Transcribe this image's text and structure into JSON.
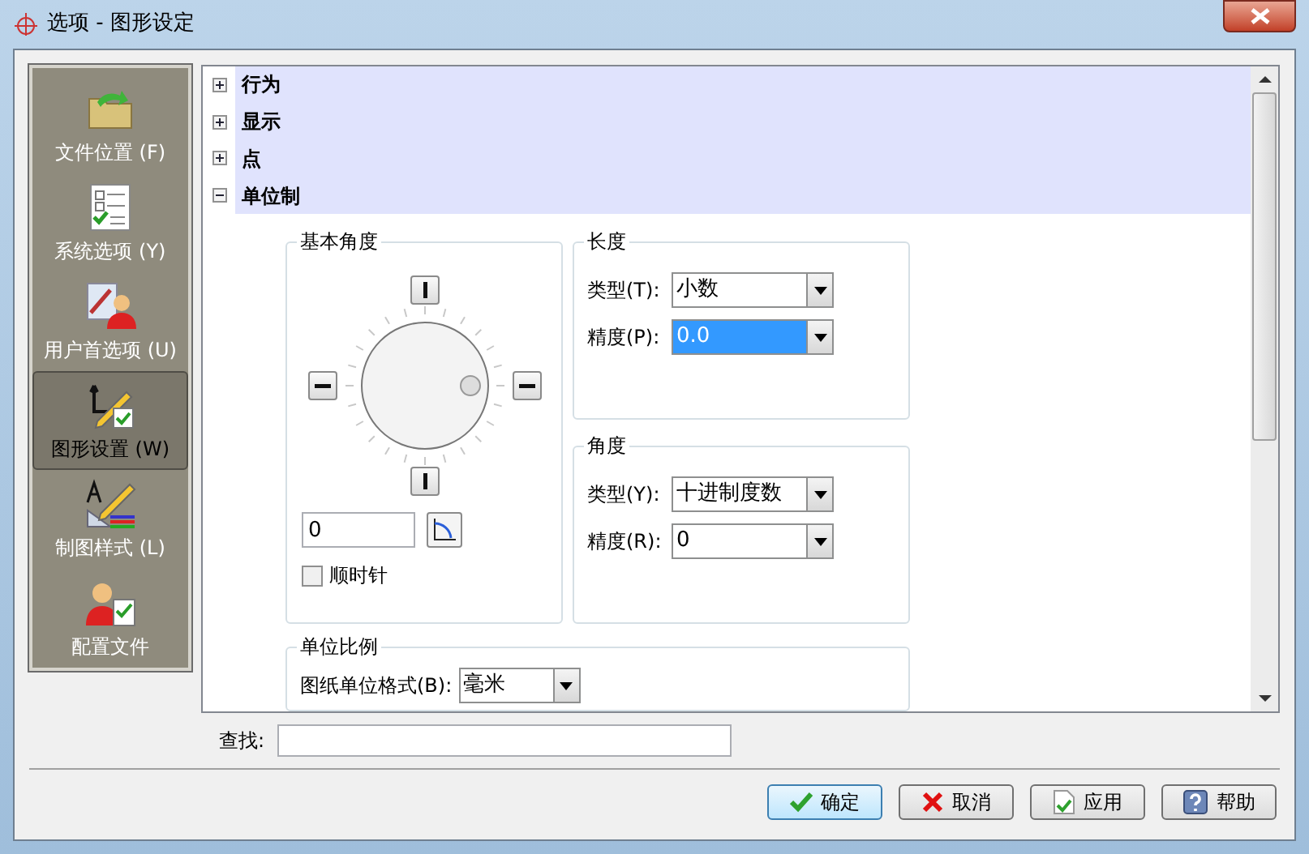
{
  "window": {
    "title": "选项 - 图形设定"
  },
  "sidebar": {
    "items": [
      {
        "label": "文件位置 (F)",
        "kind": "folder",
        "selected": false
      },
      {
        "label": "系统选项 (Y)",
        "kind": "checklist",
        "selected": false
      },
      {
        "label": "用户首选项 (U)",
        "kind": "user-pencil",
        "selected": false
      },
      {
        "label": "图形设置 (W)",
        "kind": "axes-pencil",
        "selected": true
      },
      {
        "label": "制图样式 (L)",
        "kind": "style",
        "selected": false
      },
      {
        "label": "配置文件",
        "kind": "user-check",
        "selected": false
      }
    ]
  },
  "tree": {
    "nodes": [
      {
        "label": "行为",
        "expanded": false
      },
      {
        "label": "显示",
        "expanded": false
      },
      {
        "label": "点",
        "expanded": false
      },
      {
        "label": "单位制",
        "expanded": true
      }
    ]
  },
  "base_angle": {
    "title": "基本角度",
    "value": "0",
    "clockwise": {
      "label": "顺时针",
      "checked": false
    }
  },
  "length": {
    "title": "长度",
    "fields": [
      {
        "label": "类型(T):",
        "value": "小数",
        "highlighted": false
      },
      {
        "label": "精度(P):",
        "value": "0.0",
        "highlighted": true
      }
    ]
  },
  "angle": {
    "title": "角度",
    "fields": [
      {
        "label": "类型(Y):",
        "value": "十进制度数",
        "highlighted": false
      },
      {
        "label": "精度(R):",
        "value": "0",
        "highlighted": false
      }
    ]
  },
  "unit_scale": {
    "title": "单位比例",
    "field": {
      "label": "图纸单位格式(B):",
      "value": "毫米"
    }
  },
  "search": {
    "label": "查找:"
  },
  "buttons": [
    {
      "label": "确定",
      "kind": "ok",
      "default": true
    },
    {
      "label": "取消",
      "kind": "cancel",
      "default": false
    },
    {
      "label": "应用",
      "kind": "apply",
      "default": false
    },
    {
      "label": "帮助",
      "kind": "help",
      "default": false
    }
  ]
}
